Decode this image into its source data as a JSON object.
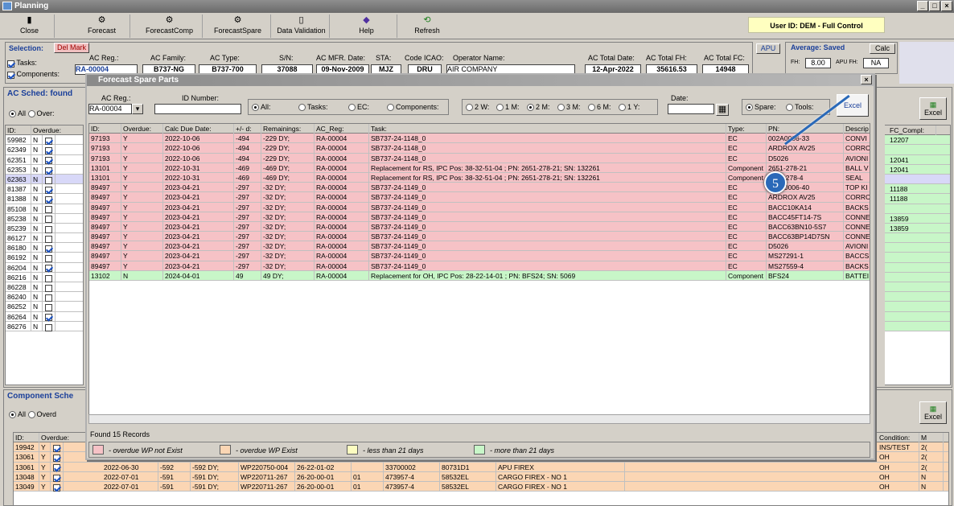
{
  "app": {
    "title": "Planning"
  },
  "toolbar": {
    "close": "Close",
    "forecast": "Forecast",
    "forecast_comp": "ForecastComp",
    "forecast_spare": "ForecastSpare",
    "data_validation": "Data Validation",
    "help": "Help",
    "refresh": "Refresh",
    "user": "User ID: DEM - Full Control"
  },
  "selection": {
    "label": "Selection:",
    "del_mark": "Del Mark",
    "tasks": "Tasks:",
    "components": "Components:",
    "ac_reg_label": "AC Reg.:",
    "ac_reg": "RA-00004",
    "ac_family_label": "AC Family:",
    "ac_family": "B737-NG",
    "ac_type_label": "AC Type:",
    "ac_type": "B737-700",
    "sn_label": "S/N:",
    "sn": "37088",
    "mfr_label": "AC MFR. Date:",
    "mfr": "09-Nov-2009",
    "sta_label": "STA:",
    "sta": "MJZ",
    "icao_label": "Code ICAO:",
    "icao": "DRU",
    "operator_label": "Operator Name:",
    "operator": "AIR COMPANY",
    "total_date_label": "AC Total Date:",
    "total_date": "12-Apr-2022",
    "total_fh_label": "AC Total FH:",
    "total_fh": "35616.53",
    "total_fc_label": "AC Total FC:",
    "total_fc": "14948"
  },
  "average": {
    "apu": "APU",
    "label": "Average: Saved",
    "calc": "Calc",
    "fh_label": "FH:",
    "fh": "8.00",
    "apufh_label": "APU FH:",
    "apufh": "NA"
  },
  "ac_sched": {
    "title": "AC Sched: found",
    "all": "All",
    "over": "Over:",
    "excel": "Excel",
    "col_id": "ID:",
    "col_overdue": "Overdue:",
    "col_fc": "FC_Compl:",
    "rows": [
      {
        "id": "59982",
        "o": "N",
        "c": true
      },
      {
        "id": "62349",
        "o": "N",
        "c": true
      },
      {
        "id": "62351",
        "o": "N",
        "c": true
      },
      {
        "id": "62353",
        "o": "N",
        "c": true
      },
      {
        "id": "62363",
        "o": "N",
        "c": false
      },
      {
        "id": "81387",
        "o": "N",
        "c": true
      },
      {
        "id": "81388",
        "o": "N",
        "c": true
      },
      {
        "id": "85108",
        "o": "N",
        "c": false
      },
      {
        "id": "85238",
        "o": "N",
        "c": false
      },
      {
        "id": "85239",
        "o": "N",
        "c": false
      },
      {
        "id": "86127",
        "o": "N",
        "c": false
      },
      {
        "id": "86180",
        "o": "N",
        "c": true
      },
      {
        "id": "86192",
        "o": "N",
        "c": false
      },
      {
        "id": "86204",
        "o": "N",
        "c": true
      },
      {
        "id": "86216",
        "o": "N",
        "c": false
      },
      {
        "id": "86228",
        "o": "N",
        "c": false
      },
      {
        "id": "86240",
        "o": "N",
        "c": false
      },
      {
        "id": "86252",
        "o": "N",
        "c": false
      },
      {
        "id": "86264",
        "o": "N",
        "c": true
      },
      {
        "id": "86276",
        "o": "N",
        "c": false
      }
    ],
    "fc_values": [
      "12207",
      "",
      "12041",
      "12041",
      "",
      "11188",
      "11188",
      "",
      "13859",
      "13859",
      "",
      "",
      "",
      "",
      "",
      "",
      "",
      "",
      "",
      ""
    ]
  },
  "comp_sched": {
    "title": "Component Sche",
    "all": "All",
    "over": "Overd",
    "excel": "Excel",
    "col_id": "ID:",
    "col_overdue": "Overdue:",
    "col_cond": "Condition:",
    "col_m": "M",
    "rows": [
      {
        "id": "19942",
        "o": "Y",
        "c1": "",
        "c2": "",
        "c3": "",
        "c4": "",
        "c5": "",
        "c6": "",
        "c7": "",
        "c8": "",
        "cond": "INS/TEST",
        "m": "2("
      },
      {
        "id": "13061",
        "o": "Y",
        "c1": "2022-06-30",
        "c2": "-592",
        "c3": "-592 DY;",
        "c4": "WP220750-004",
        "c5": "26-22-01-02",
        "c6": "",
        "c7": "33700002",
        "c8": "80731D1",
        "c9": "APU FIREX",
        "cond": "OH",
        "m": "2("
      },
      {
        "id": "13061",
        "o": "Y",
        "c1": "2022-06-30",
        "c2": "-592",
        "c3": "-592 DY;",
        "c4": "WP220750-004",
        "c5": "26-22-01-02",
        "c6": "",
        "c7": "33700002",
        "c8": "80731D1",
        "c9": "APU FIREX",
        "cond": "OH",
        "m": "2("
      },
      {
        "id": "13048",
        "o": "Y",
        "c1": "2022-07-01",
        "c2": "-591",
        "c3": "-591 DY;",
        "c4": "WP220711-267",
        "c5": "26-20-00-01",
        "c6": "01",
        "c7": "473957-4",
        "c8": "58532EL",
        "c9": "CARGO FIREX - NO 1",
        "cond": "OH",
        "m": "N"
      },
      {
        "id": "13049",
        "o": "Y",
        "c1": "2022-07-01",
        "c2": "-591",
        "c3": "-591 DY;",
        "c4": "WP220711-267",
        "c5": "26-20-00-01",
        "c6": "01",
        "c7": "473957-4",
        "c8": "58532EL",
        "c9": "CARGO FIREX - NO 1",
        "cond": "OH",
        "m": "N"
      }
    ]
  },
  "dialog": {
    "title": "Forecast Spare Parts",
    "ac_reg_label": "AC Reg.:",
    "ac_reg": "RA-00004",
    "id_label": "ID Number:",
    "all": "All:",
    "tasks": "Tasks:",
    "ec": "EC:",
    "components": "Components:",
    "w2": "2 W:",
    "m1": "1 M:",
    "m2": "2 M:",
    "m3": "3 M:",
    "m6": "6 M:",
    "y1": "1 Y:",
    "date_label": "Date:",
    "spare": "Spare:",
    "tools": "Tools:",
    "excel": "Excel",
    "found": "Found 15 Records",
    "cols": [
      "ID:",
      "Overdue:",
      "Calc Due Date:",
      "+/- d:",
      "Remainings:",
      "AC_Reg:",
      "Task:",
      "Type:",
      "PN:",
      "Descrip"
    ],
    "rows": [
      {
        "id": "97193",
        "o": "Y",
        "d": "2022-10-06",
        "pm": "-494",
        "r": "-229 DY;",
        "reg": "RA-00004",
        "task": "SB737-24-1148_0",
        "type": "EC",
        "pn": "002A0006-33",
        "desc": "CONVI",
        "cls": "red"
      },
      {
        "id": "97193",
        "o": "Y",
        "d": "2022-10-06",
        "pm": "-494",
        "r": "-229 DY;",
        "reg": "RA-00004",
        "task": "SB737-24-1148_0",
        "type": "EC",
        "pn": "ARDROX AV25",
        "desc": "CORRC",
        "cls": "red"
      },
      {
        "id": "97193",
        "o": "Y",
        "d": "2022-10-06",
        "pm": "-494",
        "r": "-229 DY;",
        "reg": "RA-00004",
        "task": "SB737-24-1148_0",
        "type": "EC",
        "pn": "D5026",
        "desc": "AVIONI",
        "cls": "red"
      },
      {
        "id": "13101",
        "o": "Y",
        "d": "2022-10-31",
        "pm": "-469",
        "r": "-469 DY;",
        "reg": "RA-00004",
        "task": "Replacement for RS, IPC Pos: 38-32-51-04 ; PN: 2651-278-21; SN: 132261",
        "type": "Component",
        "pn": "2651-278-21",
        "desc": "BALL V",
        "cls": "red"
      },
      {
        "id": "13101",
        "o": "Y",
        "d": "2022-10-31",
        "pm": "-469",
        "r": "-469 DY;",
        "reg": "RA-00004",
        "task": "Replacement for RS, IPC Pos: 38-32-51-04 ; PN: 2651-278-21; SN: 132261",
        "type": "Component",
        "pn": "2651-278-4",
        "desc": "SEAL",
        "cls": "red"
      },
      {
        "id": "89497",
        "o": "Y",
        "d": "2023-04-21",
        "pm": "-297",
        "r": "-32 DY;",
        "reg": "RA-00004",
        "task": "SB737-24-1149_0",
        "type": "EC",
        "pn": "002A0006-40",
        "desc": "TOP KI",
        "cls": "red"
      },
      {
        "id": "89497",
        "o": "Y",
        "d": "2023-04-21",
        "pm": "-297",
        "r": "-32 DY;",
        "reg": "RA-00004",
        "task": "SB737-24-1149_0",
        "type": "EC",
        "pn": "ARDROX AV25",
        "desc": "CORRC",
        "cls": "red"
      },
      {
        "id": "89497",
        "o": "Y",
        "d": "2023-04-21",
        "pm": "-297",
        "r": "-32 DY;",
        "reg": "RA-00004",
        "task": "SB737-24-1149_0",
        "type": "EC",
        "pn": "BACC10KA14",
        "desc": "BACKS",
        "cls": "red"
      },
      {
        "id": "89497",
        "o": "Y",
        "d": "2023-04-21",
        "pm": "-297",
        "r": "-32 DY;",
        "reg": "RA-00004",
        "task": "SB737-24-1149_0",
        "type": "EC",
        "pn": "BACC45FT14-7S",
        "desc": "CONNE",
        "cls": "red"
      },
      {
        "id": "89497",
        "o": "Y",
        "d": "2023-04-21",
        "pm": "-297",
        "r": "-32 DY;",
        "reg": "RA-00004",
        "task": "SB737-24-1149_0",
        "type": "EC",
        "pn": "BACC63BN10-5S7",
        "desc": "CONNE",
        "cls": "red"
      },
      {
        "id": "89497",
        "o": "Y",
        "d": "2023-04-21",
        "pm": "-297",
        "r": "-32 DY;",
        "reg": "RA-00004",
        "task": "SB737-24-1149_0",
        "type": "EC",
        "pn": "BACC63BP14D7SN",
        "desc": "CONNE",
        "cls": "red"
      },
      {
        "id": "89497",
        "o": "Y",
        "d": "2023-04-21",
        "pm": "-297",
        "r": "-32 DY;",
        "reg": "RA-00004",
        "task": "SB737-24-1149_0",
        "type": "EC",
        "pn": "D5026",
        "desc": "AVIONI",
        "cls": "red"
      },
      {
        "id": "89497",
        "o": "Y",
        "d": "2023-04-21",
        "pm": "-297",
        "r": "-32 DY;",
        "reg": "RA-00004",
        "task": "SB737-24-1149_0",
        "type": "EC",
        "pn": "MS27291-1",
        "desc": "BACCS",
        "cls": "red"
      },
      {
        "id": "89497",
        "o": "Y",
        "d": "2023-04-21",
        "pm": "-297",
        "r": "-32 DY;",
        "reg": "RA-00004",
        "task": "SB737-24-1149_0",
        "type": "EC",
        "pn": "MS27559-4",
        "desc": "BACKS",
        "cls": "red"
      },
      {
        "id": "13102",
        "o": "N",
        "d": "2024-04-01",
        "pm": "49",
        "r": "49 DY;",
        "reg": "RA-00004",
        "task": "Replacement for OH, IPC Pos: 28-22-14-01 ; PN: BFS24; SN: 5069",
        "type": "Component",
        "pn": "BFS24",
        "desc": "BATTEI",
        "cls": "green"
      }
    ],
    "legend": [
      "- overdue WP not Exist",
      "- overdue WP Exist",
      "- less than 21 days",
      "- more than 21 days"
    ],
    "legend_colors": [
      "#f6c2c6",
      "#fbd6b4",
      "#fcfcc0",
      "#c8f6c8"
    ],
    "callout": "5"
  }
}
